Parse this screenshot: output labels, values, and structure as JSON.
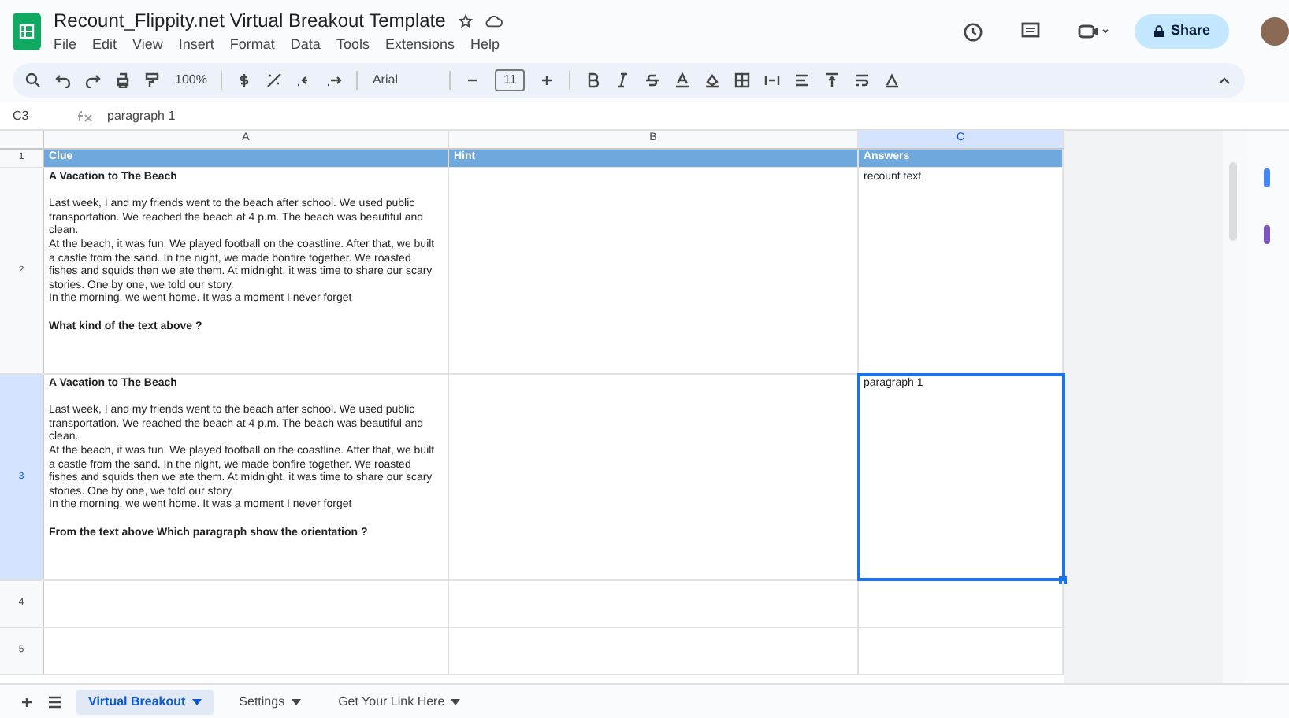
{
  "document": {
    "title": "Recount_Flippity.net Virtual Breakout Template",
    "share_label": "Share"
  },
  "menu": [
    "File",
    "Edit",
    "View",
    "Insert",
    "Format",
    "Data",
    "Tools",
    "Extensions",
    "Help"
  ],
  "toolbar": {
    "zoom": "100%",
    "font": "Arial",
    "font_size": "11"
  },
  "formula_bar": {
    "cell": "C3",
    "value": "paragraph 1"
  },
  "columns": [
    {
      "letter": "A",
      "selected": false
    },
    {
      "letter": "B",
      "selected": false
    },
    {
      "letter": "C",
      "selected": true
    }
  ],
  "rows": [
    {
      "number": "1",
      "selected": false,
      "kind": "header",
      "cells": [
        "Clue",
        "Hint",
        "Answers"
      ]
    },
    {
      "number": "2",
      "selected": false,
      "kind": "data",
      "cells": [
        "**A Vacation to The Beach**\n\nLast week, I and my friends went to the beach after school. We used public transportation. We reached the beach at 4 p.m. The beach was beautiful and clean.\nAt the beach, it was fun. We played football on the coastline. After that, we built a castle from the sand. In the night, we made bonfire together. We roasted fishes and squids then we ate them. At midnight, it was time to share our scary stories. One by one, we told our story.\nIn the morning, we went home. It was a moment I never forget\n\n**What kind of the text above ?**",
        "",
        "recount text"
      ],
      "active_answer": false
    },
    {
      "number": "3",
      "selected": true,
      "kind": "data",
      "cells": [
        "**A Vacation to The Beach**\n\nLast week, I and my friends went to the beach after school. We used public transportation. We reached the beach at 4 p.m. The beach was beautiful and clean.\nAt the beach, it was fun. We played football on the coastline. After that, we built a castle from the sand. In the night, we made bonfire together. We roasted fishes and squids then we ate them. At midnight, it was time to share our scary stories. One by one, we told our story.\nIn the morning, we went home. It was a moment I never forget\n\n**From the text above Which paragraph show the orientation ?**",
        "",
        "paragraph 1"
      ],
      "active_answer": true
    },
    {
      "number": "4",
      "selected": false,
      "kind": "empty"
    },
    {
      "number": "5",
      "selected": false,
      "kind": "empty"
    }
  ],
  "sheet_tabs": [
    {
      "label": "Virtual Breakout",
      "selected": true
    },
    {
      "label": "Settings",
      "selected": false
    },
    {
      "label": "Get Your Link Here",
      "selected": false
    }
  ]
}
